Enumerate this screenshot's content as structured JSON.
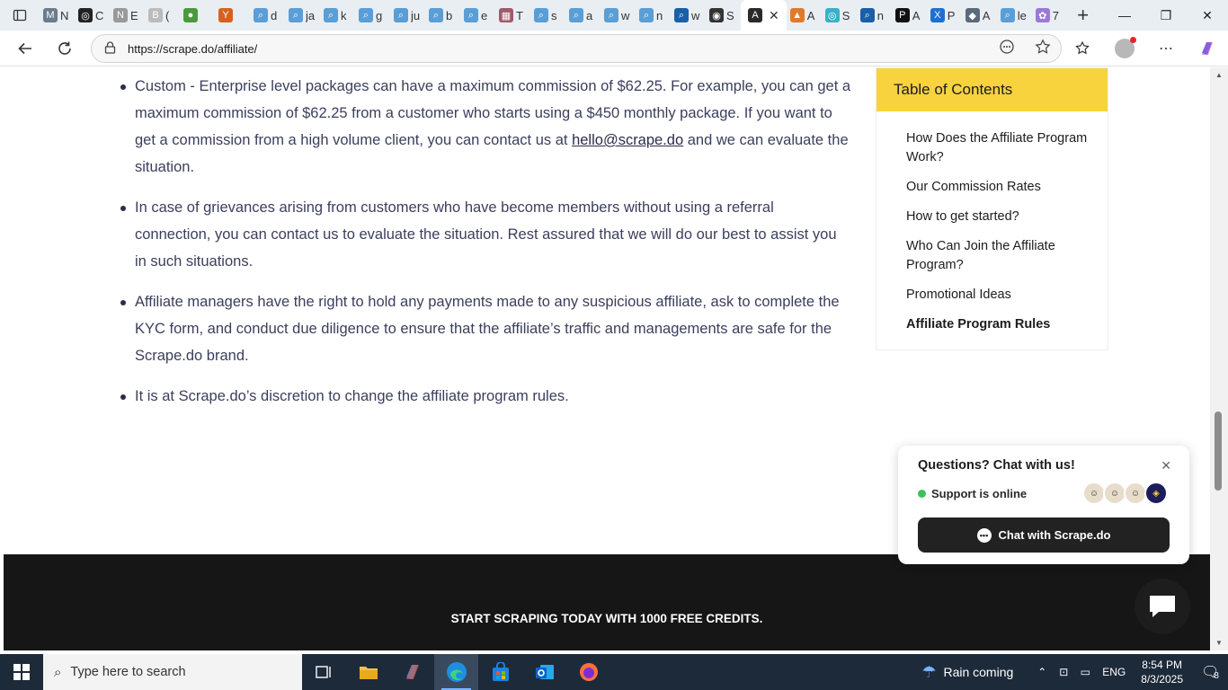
{
  "browser": {
    "tabs": [
      {
        "fav": "M",
        "title": "N",
        "color": "#6b7c8c"
      },
      {
        "fav": "◎",
        "title": "C",
        "color": "#222"
      },
      {
        "fav": "N",
        "title": "E",
        "color": "#999"
      },
      {
        "fav": "B",
        "title": "(",
        "color": "#bbb"
      },
      {
        "fav": "●",
        "title": "",
        "color": "#4a9a3c"
      },
      {
        "fav": "Y",
        "title": "",
        "color": "#d4621e"
      },
      {
        "fav": "⌕",
        "title": "d",
        "color": "#5a9ed6"
      },
      {
        "fav": "⌕",
        "title": "ja",
        "color": "#5a9ed6"
      },
      {
        "fav": "⌕",
        "title": "k",
        "color": "#5a9ed6"
      },
      {
        "fav": "⌕",
        "title": "g",
        "color": "#5a9ed6"
      },
      {
        "fav": "⌕",
        "title": "ju",
        "color": "#5a9ed6"
      },
      {
        "fav": "⌕",
        "title": "b",
        "color": "#5a9ed6"
      },
      {
        "fav": "⌕",
        "title": "e",
        "color": "#5a9ed6"
      },
      {
        "fav": "▦",
        "title": "T",
        "color": "#a05a6a"
      },
      {
        "fav": "⌕",
        "title": "s",
        "color": "#5a9ed6"
      },
      {
        "fav": "⌕",
        "title": "a",
        "color": "#5a9ed6"
      },
      {
        "fav": "⌕",
        "title": "w",
        "color": "#5a9ed6"
      },
      {
        "fav": "⌕",
        "title": "n",
        "color": "#5a9ed6"
      },
      {
        "fav": "⌕",
        "title": "w",
        "color": "#1a5fa8"
      },
      {
        "fav": "◉",
        "title": "S",
        "color": "#333"
      }
    ],
    "active_tab": {
      "fav": "A",
      "close": "✕"
    },
    "tabs_after": [
      {
        "fav": "▲",
        "title": "A",
        "color": "#e07a2a"
      },
      {
        "fav": "◎",
        "title": "S",
        "color": "#3ab0c8"
      },
      {
        "fav": "⌕",
        "title": "n",
        "color": "#1a5fa8"
      },
      {
        "fav": "P",
        "title": "A",
        "color": "#111"
      },
      {
        "fav": "X",
        "title": "P",
        "color": "#1f6fd1"
      },
      {
        "fav": "◆",
        "title": "A",
        "color": "#5a6a7a"
      },
      {
        "fav": "⌕",
        "title": "le",
        "color": "#5a9ed6"
      },
      {
        "fav": "✿",
        "title": "7",
        "color": "#9a7ad6"
      }
    ],
    "new_tab": "+",
    "window": {
      "minimize": "—",
      "restore": "❐",
      "close": "✕"
    },
    "url": "https://scrape.do/affiliate/"
  },
  "article": {
    "rules": [
      {
        "text_a": "Custom - Enterprise level packages can have a maximum commission of $62.25. For example, you can get a maximum commission of $62.25 from a customer who starts using a $450 monthly package. If you want to get a commission from a high volume client, you can contact us at ",
        "link": "hello@scrape.do",
        "text_b": " and we can evaluate the situation."
      },
      {
        "text": "In case of grievances arising from customers who have become members without using a referral connection, you can contact us to evaluate the situation. Rest assured that we will do our best to assist you in such situations."
      },
      {
        "text": "Affiliate managers have the right to hold any payments made to any suspicious affiliate, ask to complete the KYC form, and conduct due diligence to ensure that the affiliate’s traffic and managements are safe for the Scrape.do brand."
      },
      {
        "text": "It is at Scrape.do’s discretion to change the affiliate program rules."
      }
    ]
  },
  "toc": {
    "title": "Table of Contents",
    "items": [
      "How Does the Affiliate Program Work?",
      "Our Commission Rates",
      "How to get started?",
      "Who Can Join the Affiliate Program?",
      "Promotional Ideas",
      "Affiliate Program Rules"
    ],
    "active_index": 5
  },
  "chat": {
    "title": "Questions? Chat with us!",
    "close": "✕",
    "status": "Support is online",
    "button": "Chat with Scrape.do"
  },
  "footer": {
    "cta": "START SCRAPING TODAY WITH 1000 FREE CREDITS."
  },
  "taskbar": {
    "search_placeholder": "Type here to search",
    "weather": "Rain coming",
    "lang": "ENG",
    "time": "8:54 PM",
    "date": "8/3/2025",
    "notif_count": "8"
  }
}
